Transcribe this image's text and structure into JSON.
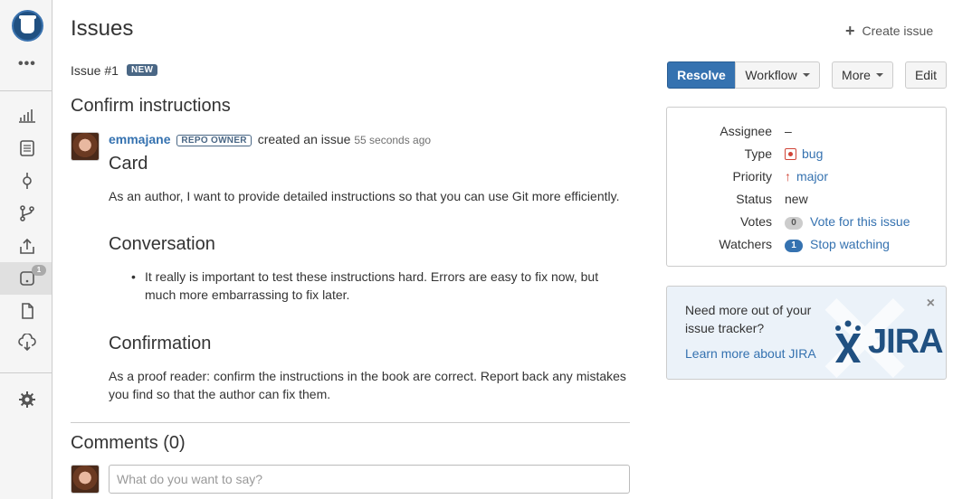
{
  "sidebar": {
    "more_label": "•••",
    "issues_badge": "1",
    "items": [
      {
        "name": "overview-icon"
      },
      {
        "name": "source-icon"
      },
      {
        "name": "commits-icon"
      },
      {
        "name": "branches-icon"
      },
      {
        "name": "pull-requests-icon"
      },
      {
        "name": "issues-icon"
      },
      {
        "name": "wiki-icon"
      },
      {
        "name": "downloads-icon"
      },
      {
        "name": "settings-icon"
      }
    ]
  },
  "header": {
    "title": "Issues",
    "create_issue": "Create issue"
  },
  "issue": {
    "number": "Issue #1",
    "status_badge": "NEW",
    "title": "Confirm instructions",
    "author": "emmajane",
    "author_role": "REPO OWNER",
    "action": "created an issue",
    "time": "55 seconds ago",
    "body": {
      "h1": "Card",
      "p1": "As an author, I want to provide detailed instructions so that you can use Git more efficiently.",
      "h2": "Conversation",
      "bullet": "It really is important to test these instructions hard. Errors are easy to fix now, but much more embarrassing to fix later.",
      "h3": "Confirmation",
      "p2": "As a proof reader: confirm the instructions in the book are correct. Report back any mistakes you find so that the author can fix them."
    }
  },
  "actions": {
    "resolve": "Resolve",
    "workflow": "Workflow",
    "more": "More",
    "edit": "Edit"
  },
  "details": {
    "assignee_label": "Assignee",
    "assignee_value": "–",
    "type_label": "Type",
    "type_value": "bug",
    "priority_label": "Priority",
    "priority_value": "major",
    "status_label": "Status",
    "status_value": "new",
    "votes_label": "Votes",
    "votes_count": "0",
    "votes_link": "Vote for this issue",
    "watchers_label": "Watchers",
    "watchers_count": "1",
    "watchers_link": "Stop watching"
  },
  "jira": {
    "text": "Need more out of your issue tracker?",
    "link": "Learn more about JIRA",
    "logo_word": "JIRA",
    "close": "×"
  },
  "comments": {
    "title": "Comments (0)",
    "placeholder": "What do you want to say?"
  },
  "colors": {
    "primary": "#3572b0",
    "badge": "#4a6785",
    "bug": "#d04437"
  }
}
